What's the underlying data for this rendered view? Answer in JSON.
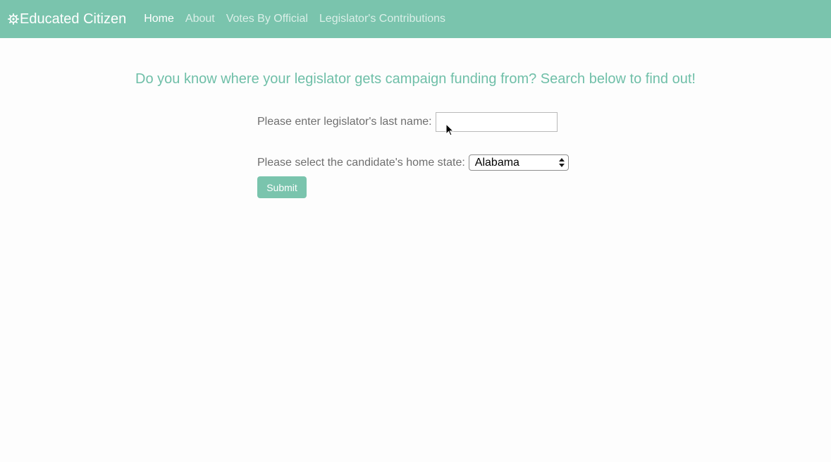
{
  "nav": {
    "brand_label": "Educated Citizen",
    "brand_icon": "gear-icon",
    "links": [
      {
        "label": "Home",
        "active": true
      },
      {
        "label": "About",
        "active": false
      },
      {
        "label": "Votes By Official",
        "active": false
      },
      {
        "label": "Legislator's Contributions",
        "active": false
      }
    ]
  },
  "main": {
    "headline": "Do you know where your legislator gets campaign funding from? Search below to find out!",
    "form": {
      "last_name_label": "Please enter legislator's last name:",
      "last_name_value": "",
      "state_label": "Please select the candidate's home state:",
      "state_selected": "Alabama",
      "submit_label": "Submit"
    }
  },
  "colors": {
    "accent": "#7ac4ad",
    "headline": "#6fbfa8",
    "label_text": "#6f6f6f",
    "background": "#fdfdfd"
  }
}
